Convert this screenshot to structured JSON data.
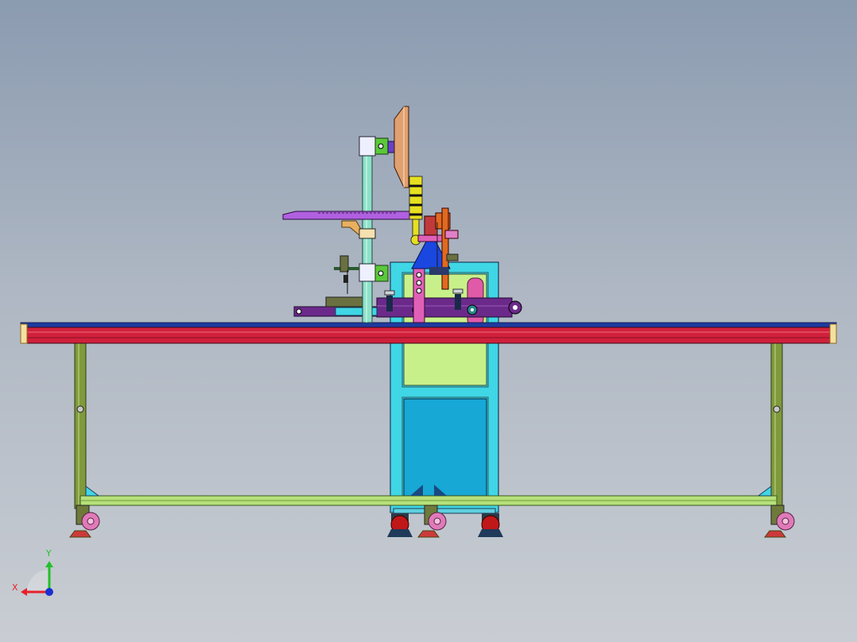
{
  "triad": {
    "x_label": "X",
    "y_label": "Y",
    "x_color": "#e8202a",
    "y_color": "#22c02a",
    "z_color": "#1a2fd0"
  },
  "colors": {
    "background_top": "#8b9bb0",
    "background_bottom": "#c9cdd3",
    "table_rail_top": "#1e3aa0",
    "table_rail_main": "#d0203c",
    "leg_frame": "#7f9a3c",
    "lower_crossbar": "#b6e07a",
    "cabinet": "#3fd6e6",
    "cabinet_upper_panel": "#c8f08a",
    "cabinet_lower_panel": "#17a8d6",
    "conveyor": "#6b2a8a",
    "funnel": "#1a47e0",
    "column": "#8fe0c8",
    "display_panel": "#e0a070",
    "arm_plate": "#b060e0",
    "tower_light": "#e6e020",
    "caster_wheel": "#e07ab8"
  }
}
